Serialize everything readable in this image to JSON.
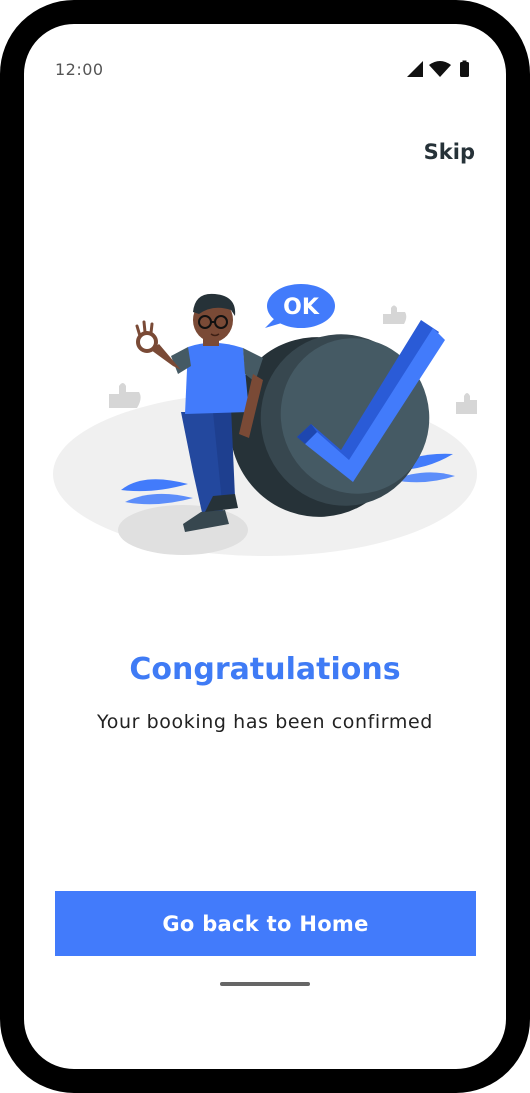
{
  "status_bar": {
    "time": "12:00",
    "icons": [
      "signal-icon",
      "wifi-icon",
      "battery-icon"
    ]
  },
  "header": {
    "skip_label": "Skip"
  },
  "illustration": {
    "bubble_text": "OK"
  },
  "content": {
    "title": "Congratulations",
    "subtitle": "Your booking has been confirmed"
  },
  "actions": {
    "home_button_label": "Go back to Home"
  },
  "colors": {
    "accent": "#427bfb",
    "title": "#3f7bf5",
    "frame": "#000000",
    "dark_shape": "#37474f"
  }
}
